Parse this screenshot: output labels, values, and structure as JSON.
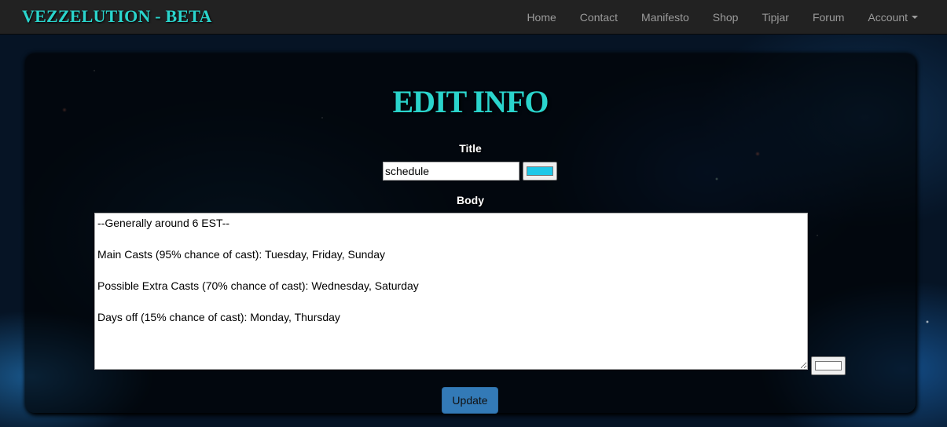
{
  "navbar": {
    "brand": "VEZZELUTION - BETA",
    "items": [
      {
        "label": "Home"
      },
      {
        "label": "Contact"
      },
      {
        "label": "Manifesto"
      },
      {
        "label": "Shop"
      },
      {
        "label": "Tipjar"
      },
      {
        "label": "Forum"
      },
      {
        "label": "Account"
      }
    ]
  },
  "form": {
    "heading": "EDIT INFO",
    "title_label": "Title",
    "title_value": "schedule",
    "title_color": "#1ec8e8",
    "body_label": "Body",
    "body_value": "--Generally around 6 EST--\n\nMain Casts (95% chance of cast): Tuesday, Friday, Sunday\n\nPossible Extra Casts (70% chance of cast): Wednesday, Saturday\n\nDays off (15% chance of cast): Monday, Thursday",
    "body_color": "#ffffff",
    "submit_label": "Update"
  },
  "colors": {
    "accent": "#2ad4cc",
    "navbar_bg": "#222222",
    "button_primary": "#337ab7"
  }
}
